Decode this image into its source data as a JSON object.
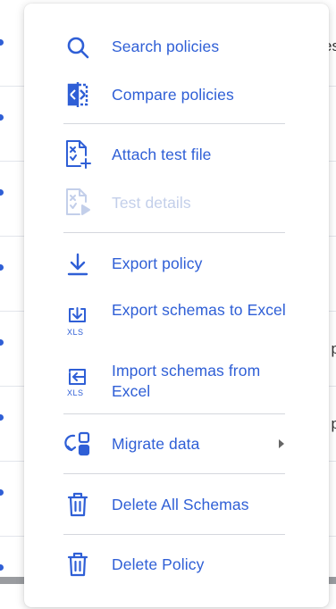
{
  "background": {
    "row_fragments": [
      "es",
      "p",
      "p"
    ]
  },
  "menu": {
    "items": [
      {
        "label": "Search policies",
        "icon": "search-icon",
        "enabled": true
      },
      {
        "label": "Compare policies",
        "icon": "compare-icon",
        "enabled": true
      },
      {
        "label": "Attach test file",
        "icon": "attach-file-icon",
        "enabled": true
      },
      {
        "label": "Test details",
        "icon": "test-details-icon",
        "enabled": false
      },
      {
        "label": "Export policy",
        "icon": "download-icon",
        "enabled": true
      },
      {
        "label": "Export schemas to Excel",
        "icon": "export-xls-icon",
        "enabled": true
      },
      {
        "label": "Import schemas from Excel",
        "icon": "import-xls-icon",
        "enabled": true
      },
      {
        "label": "Migrate data",
        "icon": "migrate-icon",
        "enabled": true,
        "has_submenu": true
      },
      {
        "label": "Delete All Schemas",
        "icon": "trash-icon",
        "enabled": true
      },
      {
        "label": "Delete Policy",
        "icon": "trash-icon",
        "enabled": true
      }
    ],
    "xls_badge": "XLS"
  },
  "colors": {
    "accent": "#2f5fd6",
    "disabled": "#c3cfea",
    "separator": "#d4d7dd"
  }
}
